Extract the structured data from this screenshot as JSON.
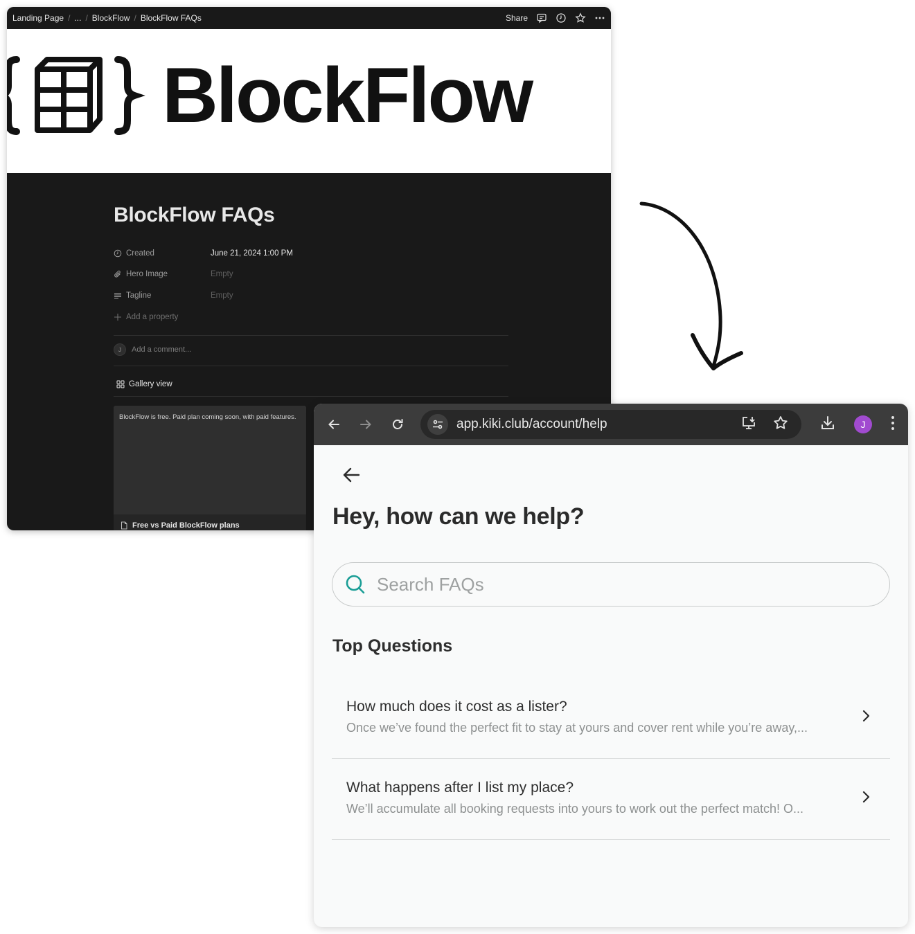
{
  "notion": {
    "breadcrumbs": [
      "Landing Page",
      "...",
      "BlockFlow",
      "BlockFlow FAQs"
    ],
    "share_label": "Share",
    "hero_wordmark": "BlockFlow",
    "page_title": "BlockFlow FAQs",
    "properties": [
      {
        "label": "Created",
        "value": "June 21, 2024 1:00 PM",
        "icon": "clock-icon"
      },
      {
        "label": "Hero Image",
        "value": "Empty",
        "icon": "paperclip-icon"
      },
      {
        "label": "Tagline",
        "value": "Empty",
        "icon": "text-lines-icon"
      }
    ],
    "add_property": "Add a property",
    "comment_avatar": "J",
    "comment_placeholder": "Add a comment...",
    "gallery_view": "Gallery view",
    "cards": [
      {
        "preview": "BlockFlow is free. Paid plan coming soon, with paid features.",
        "title": "Free vs Paid BlockFlow plans"
      }
    ]
  },
  "browser": {
    "url": "app.kiki.club/account/help",
    "profile_initial": "J",
    "profile_color": "#a14bd0",
    "page": {
      "title": "Hey, how can we help?",
      "search_placeholder": "Search FAQs",
      "section_title": "Top Questions",
      "questions": [
        {
          "title": "How much does it cost as a lister?",
          "snippet": "Once we’ve found the perfect fit to stay at yours and cover rent while you’re away,..."
        },
        {
          "title": "What happens after I list my place?",
          "snippet": "We’ll accumulate all booking requests into yours to work out the perfect match! O..."
        }
      ]
    }
  },
  "colors": {
    "notion_bg": "#191919",
    "browser_toolbar": "#3c3c3c",
    "search_icon": "#1a9e96"
  }
}
